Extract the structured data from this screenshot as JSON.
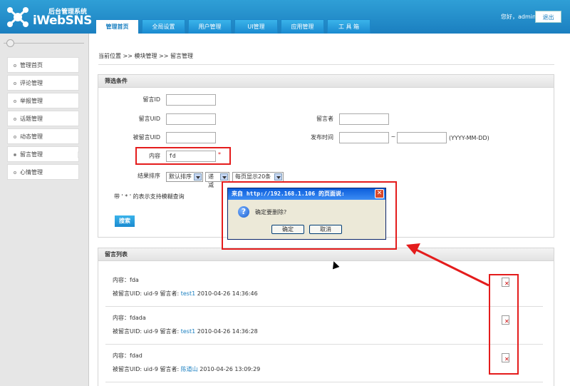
{
  "header": {
    "logo_sub": "后台管理系统",
    "logo_main": "iWebSNS",
    "welcome": "您好，admin",
    "logout_label": "退出",
    "tabs": [
      "管理首页",
      "全局设置",
      "用户管理",
      "UI管理",
      "应用管理",
      "工 具 箱"
    ]
  },
  "sidebar": {
    "items": [
      {
        "label": "管理首页"
      },
      {
        "label": "评论管理"
      },
      {
        "label": "举报管理"
      },
      {
        "label": "话题管理"
      },
      {
        "label": "动态管理"
      },
      {
        "label": "留言管理"
      },
      {
        "label": "心情管理"
      }
    ]
  },
  "breadcrumb": "当前位置 >> 模块管理 >> 留言管理",
  "filter": {
    "title": "筛选条件",
    "msg_id_label": "留言ID",
    "msg_uid_label": "留言UID",
    "author_label": "留言者",
    "target_uid_label": "被留言UID",
    "time_label": "发布时间",
    "date_sep": "~",
    "date_hint": "(YYYY-MM-DD)",
    "content_label": "内容",
    "content_value": "fd",
    "required_mark": "*",
    "sort_label": "结果排序",
    "sort_value": "默认排序",
    "order_value": "递减",
    "per_page_value": "每页显示20条",
    "note": "带 ' * ' 的表示支持模糊查询",
    "search_label": "搜索"
  },
  "list": {
    "title": "留言列表",
    "items": [
      {
        "content_label": "内容：",
        "content": "fda",
        "meta": "被留言UID: uid-9 留言者: ",
        "user": "test1",
        "time": " 2010-04-26 14:36:46"
      },
      {
        "content_label": "内容：",
        "content": "fdada",
        "meta": "被留言UID: uid-9 留言者: ",
        "user": "test1",
        "time": " 2010-04-26 14:36:28"
      },
      {
        "content_label": "内容：",
        "content": "fdad",
        "meta": "被留言UID: uid-9 留言者: ",
        "user": "陈道山",
        "time": " 2010-04-26 13:09:29"
      }
    ]
  },
  "dialog": {
    "title": "来自 http://192.168.1.106 的页面说:",
    "message": "确定要删除?",
    "ok_label": "确定",
    "cancel_label": "取消",
    "close_glyph": "✕",
    "icon_glyph": "?"
  },
  "colors": {
    "header": "#1b7fc0",
    "annotation": "#e41c1c",
    "link": "#1a7fc0"
  }
}
